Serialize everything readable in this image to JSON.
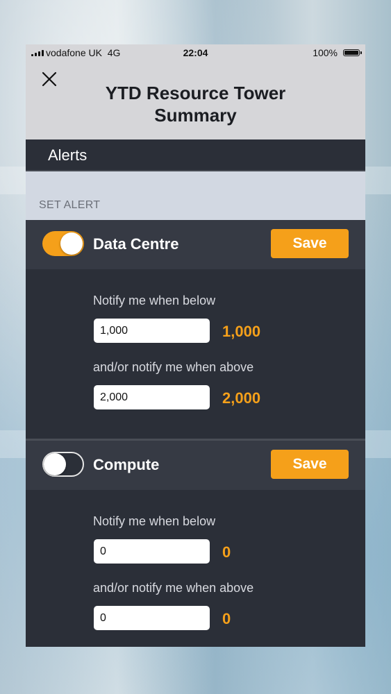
{
  "status_bar": {
    "carrier": "vodafone UK",
    "network": "4G",
    "time": "22:04",
    "battery_percent": "100%"
  },
  "header": {
    "title": "YTD Resource Tower Summary",
    "close_icon": "close-x-icon"
  },
  "section": {
    "title": "Alerts"
  },
  "set_alert_label": "SET ALERT",
  "alerts": [
    {
      "name": "Data Centre",
      "enabled": true,
      "save_label": "Save",
      "below_label": "Notify me when below",
      "below_value": "1,000",
      "below_display": "1,000",
      "above_label": "and/or notify me when above",
      "above_value": "2,000",
      "above_display": "2,000"
    },
    {
      "name": "Compute",
      "enabled": false,
      "save_label": "Save",
      "below_label": "Notify me when below",
      "below_value": "0",
      "below_display": "0",
      "above_label": "and/or notify me when above",
      "above_value": "0",
      "above_display": "0"
    }
  ],
  "colors": {
    "accent": "#f5a01a",
    "panel_dark": "#2b2f38",
    "panel_head": "#363a44",
    "header_bg": "#d6d6d9",
    "set_alert_bg": "#d2d8e2"
  }
}
